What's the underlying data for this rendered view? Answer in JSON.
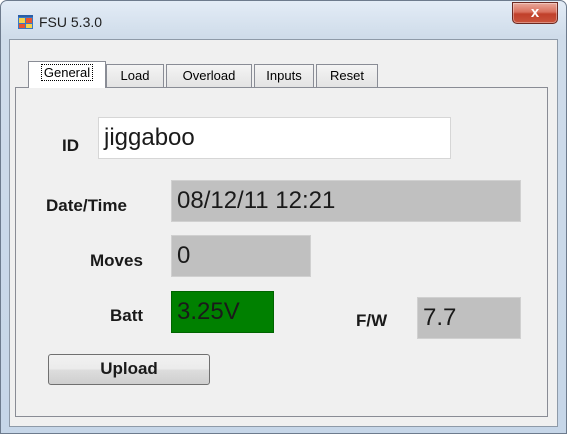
{
  "window": {
    "title": "FSU 5.3.0",
    "close_glyph": "x"
  },
  "tabs": [
    {
      "label": "General",
      "active": true
    },
    {
      "label": "Load",
      "active": false
    },
    {
      "label": "Overload",
      "active": false
    },
    {
      "label": "Inputs",
      "active": false
    },
    {
      "label": "Reset",
      "active": false
    }
  ],
  "general": {
    "id_label": "ID",
    "id_value": "jiggaboo",
    "datetime_label": "Date/Time",
    "datetime_value": "08/12/11 12:21",
    "moves_label": "Moves",
    "moves_value": "0",
    "batt_label": "Batt",
    "batt_value": "3.25V",
    "fw_label": "F/W",
    "fw_value": "7.7",
    "upload_label": "Upload"
  },
  "colors": {
    "batt_ok": "#008000",
    "readonly_field": "#c0c0c0",
    "close_button": "#c9533c"
  },
  "icons": {
    "app": "app-window-icon",
    "close": "close-icon"
  }
}
